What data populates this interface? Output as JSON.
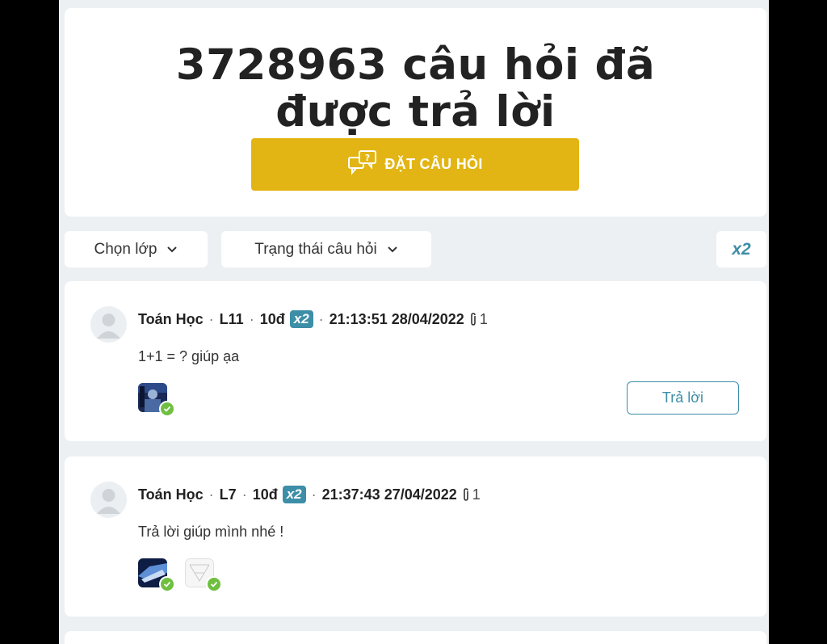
{
  "hero": {
    "title_line1": "3728963 câu hỏi đã",
    "title_line2": "được trả lời",
    "ask_button": "ĐẶT CÂU HỎI"
  },
  "filters": {
    "grade": "Chọn lớp",
    "status": "Trạng thái câu hỏi",
    "x2": "x2"
  },
  "questions": [
    {
      "subject": "Toán Học",
      "grade": "L11",
      "points": "10đ",
      "badge": "x2",
      "datetime": "21:13:51 28/04/2022",
      "attachments": "1",
      "text": "1+1 = ? giúp ạa",
      "reply_label": "Trả lời"
    },
    {
      "subject": "Toán Học",
      "grade": "L7",
      "points": "10đ",
      "badge": "x2",
      "datetime": "21:37:43 27/04/2022",
      "attachments": "1",
      "text": "Trả lời giúp mình nhé !"
    }
  ],
  "colors": {
    "accent": "#e2b514",
    "teal": "#3d8ea7",
    "check": "#6fbf40",
    "background": "#edf0f3"
  },
  "icons": [
    "chat-question-icon",
    "chevron-down-icon",
    "paperclip-icon",
    "default-avatar-icon",
    "verified-check-icon"
  ]
}
